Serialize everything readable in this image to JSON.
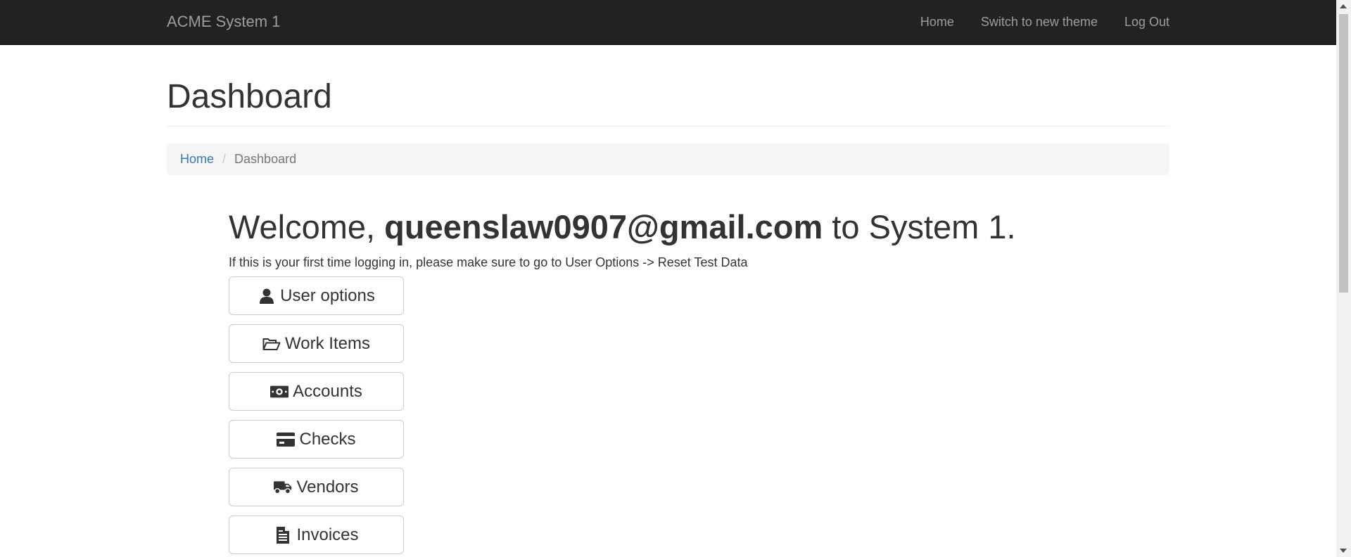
{
  "navbar": {
    "brand": "ACME System 1",
    "links": [
      "Home",
      "Switch to new theme",
      "Log Out"
    ]
  },
  "header": {
    "title": "Dashboard"
  },
  "breadcrumb": {
    "items": [
      "Home",
      "Dashboard"
    ]
  },
  "welcome": {
    "prefix": "Welcome,",
    "user": "queenslaw0907@gmail.com",
    "suffix": "to System 1.",
    "hint": "If this is your first time logging in, please make sure to go to User Options -> Reset Test Data"
  },
  "buttons": [
    {
      "label": "User options",
      "icon": "user-icon"
    },
    {
      "label": "Work Items",
      "icon": "folder-open-icon"
    },
    {
      "label": "Accounts",
      "icon": "money-icon"
    },
    {
      "label": "Checks",
      "icon": "credit-card-icon"
    },
    {
      "label": "Vendors",
      "icon": "truck-icon"
    },
    {
      "label": "Invoices",
      "icon": "file-text-icon"
    }
  ],
  "colors": {
    "navbar_bg": "#222222",
    "navbar_text": "#9d9d9d",
    "link": "#337ab7",
    "breadcrumb_bg": "#f5f5f5"
  }
}
